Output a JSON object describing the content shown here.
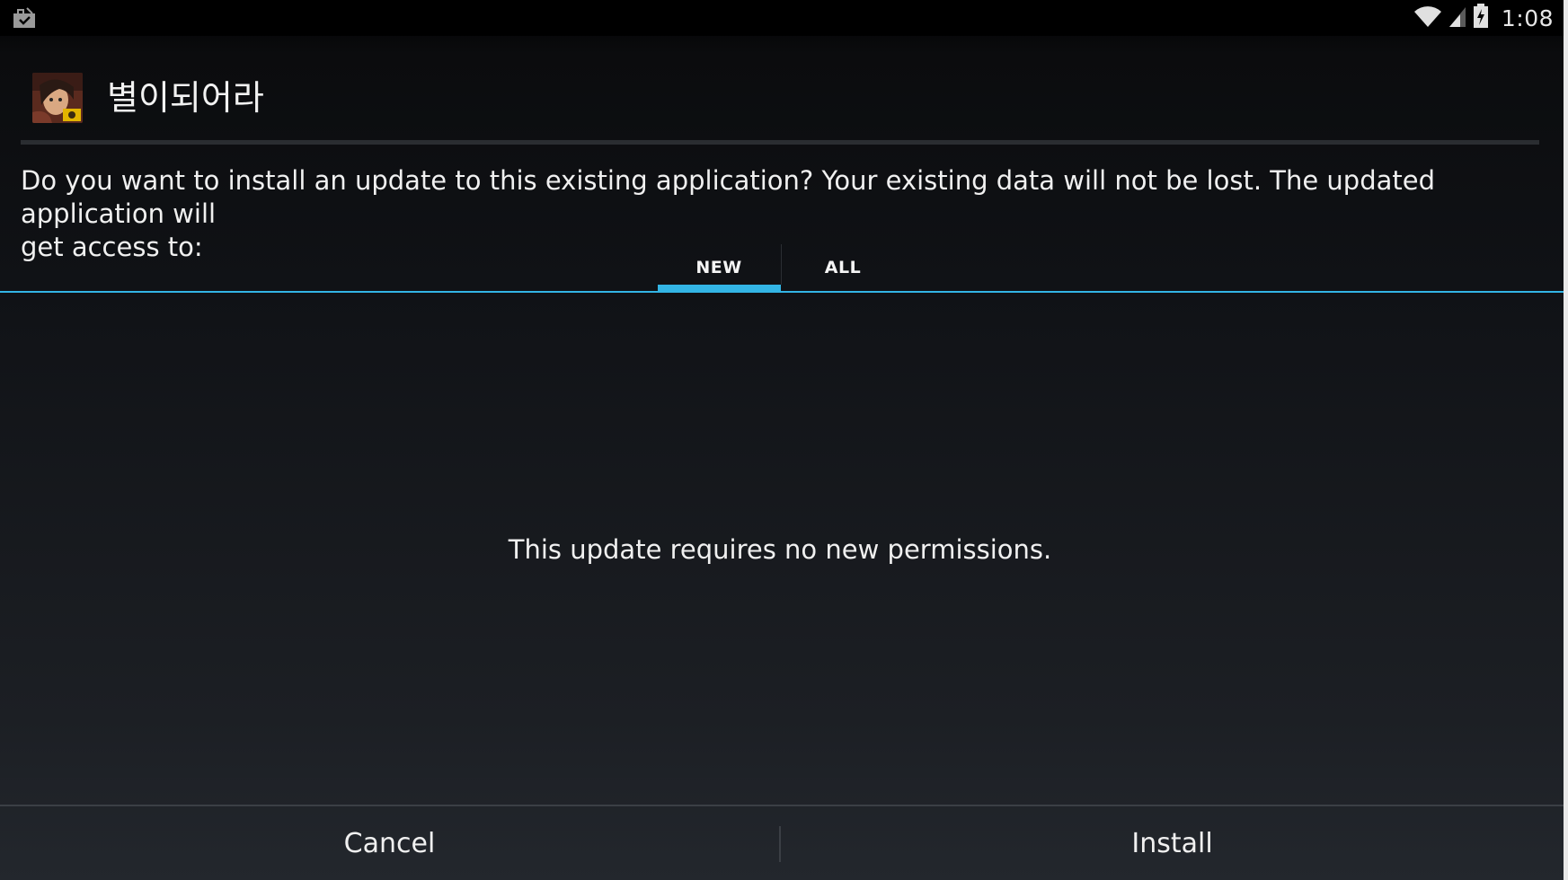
{
  "status_bar": {
    "time": "1:08",
    "icons": [
      "notification-store-icon",
      "wifi-icon",
      "cell-signal-icon",
      "battery-charging-icon"
    ]
  },
  "dialog": {
    "app_title": "별이되어라",
    "app_icon": "app-game-icon",
    "description": "Do you want to install an update to this existing application? Your existing data will not be lost. The updated application will\nget access to:",
    "tabs": [
      {
        "label": "NEW",
        "selected": true
      },
      {
        "label": "ALL",
        "selected": false
      }
    ],
    "empty_message": "This update requires no new permissions.",
    "buttons": {
      "cancel": "Cancel",
      "install": "Install"
    }
  },
  "colors": {
    "accent": "#33b5e5",
    "background_top": "#000000",
    "background_bottom": "#23272d"
  }
}
